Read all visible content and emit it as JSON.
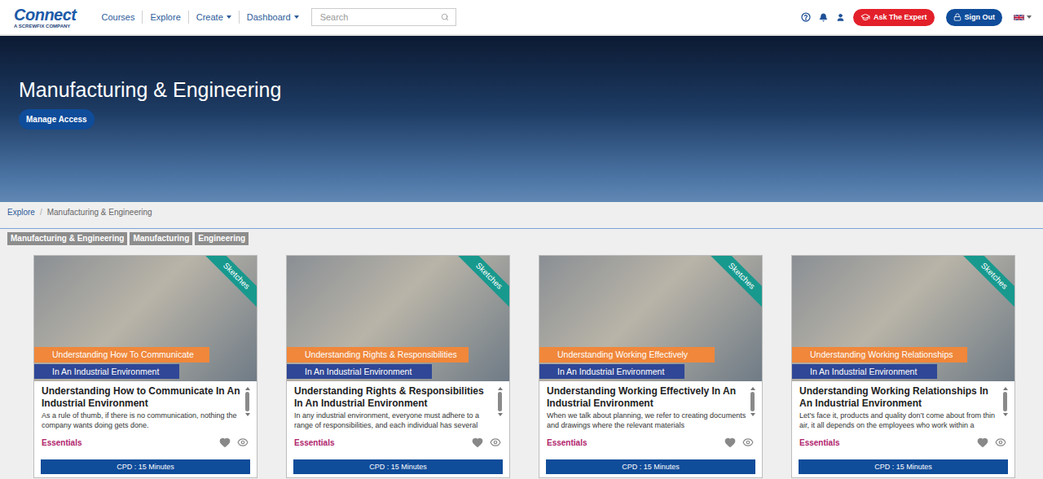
{
  "header": {
    "logo": {
      "name": "Connect",
      "tagline": "A SCREWFIX COMPANY"
    },
    "nav": [
      {
        "label": "Courses",
        "dropdown": false
      },
      {
        "label": "Explore",
        "dropdown": false
      },
      {
        "label": "Create",
        "dropdown": true
      },
      {
        "label": "Dashboard",
        "dropdown": true
      }
    ],
    "search": {
      "placeholder": "Search"
    },
    "ask_button": "Ask The Expert",
    "sign_out_button": "Sign Out"
  },
  "hero": {
    "title": "Manufacturing & Engineering",
    "button": "Manage Access"
  },
  "breadcrumb": {
    "items": [
      "Explore",
      "Manufacturing & Engineering"
    ],
    "separator": "/"
  },
  "tags": [
    "Manufacturing & Engineering",
    "Manufacturing",
    "Engineering"
  ],
  "cards": [
    {
      "ribbon": "Sketches",
      "label_top": "Understanding How To Communicate",
      "label_bottom": "In An Industrial Environment",
      "title": "Understanding How to Communicate In An Industrial Environment",
      "description": "As a rule of thumb, if there is no communication, nothing the company wants doing gets done.",
      "category": "Essentials",
      "cpd": "CPD : 15 Minutes"
    },
    {
      "ribbon": "Sketches",
      "label_top": "Understanding Rights & Responsibilities",
      "label_bottom": "In An Industrial Environment",
      "title": "Understanding Rights & Responsibilities In An Industrial Environment",
      "description": "In any industrial environment, everyone must adhere to a range of responsibilities, and each individual has several",
      "category": "Essentials",
      "cpd": "CPD : 15 Minutes"
    },
    {
      "ribbon": "Sketches",
      "label_top": "Understanding Working Effectively",
      "label_bottom": "In An Industrial Environment",
      "title": "Understanding Working Effectively In An Industrial Environment",
      "description": "When we talk about planning, we refer to creating documents and drawings where the relevant materials",
      "category": "Essentials",
      "cpd": "CPD : 15 Minutes"
    },
    {
      "ribbon": "Sketches",
      "label_top": "Understanding Working Relationships",
      "label_bottom": "In An Industrial Environment",
      "title": "Understanding Working Relationships In An Industrial Environment",
      "description": "Let’s face it, products and quality don’t come about from thin air, it all depends on the employees who work within a",
      "category": "Essentials",
      "cpd": "CPD : 15 Minutes"
    }
  ]
}
